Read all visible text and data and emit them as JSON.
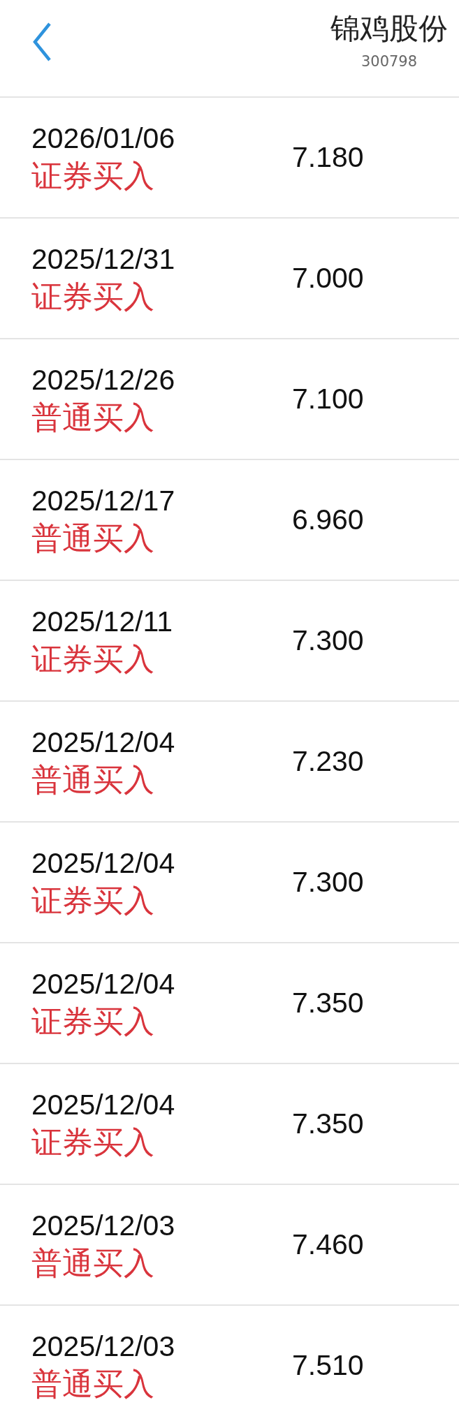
{
  "header": {
    "title": "锦鸡股份",
    "code": "300798"
  },
  "trades": [
    {
      "date": "2026/01/06",
      "type": "证券买入",
      "price": "7.180"
    },
    {
      "date": "2025/12/31",
      "type": "证券买入",
      "price": "7.000"
    },
    {
      "date": "2025/12/26",
      "type": "普通买入",
      "price": "7.100"
    },
    {
      "date": "2025/12/17",
      "type": "普通买入",
      "price": "6.960"
    },
    {
      "date": "2025/12/11",
      "type": "证券买入",
      "price": "7.300"
    },
    {
      "date": "2025/12/04",
      "type": "普通买入",
      "price": "7.230"
    },
    {
      "date": "2025/12/04",
      "type": "证券买入",
      "price": "7.300"
    },
    {
      "date": "2025/12/04",
      "type": "证券买入",
      "price": "7.350"
    },
    {
      "date": "2025/12/04",
      "type": "证券买入",
      "price": "7.350"
    },
    {
      "date": "2025/12/03",
      "type": "普通买入",
      "price": "7.460"
    },
    {
      "date": "2025/12/03",
      "type": "普通买入",
      "price": "7.510"
    }
  ]
}
